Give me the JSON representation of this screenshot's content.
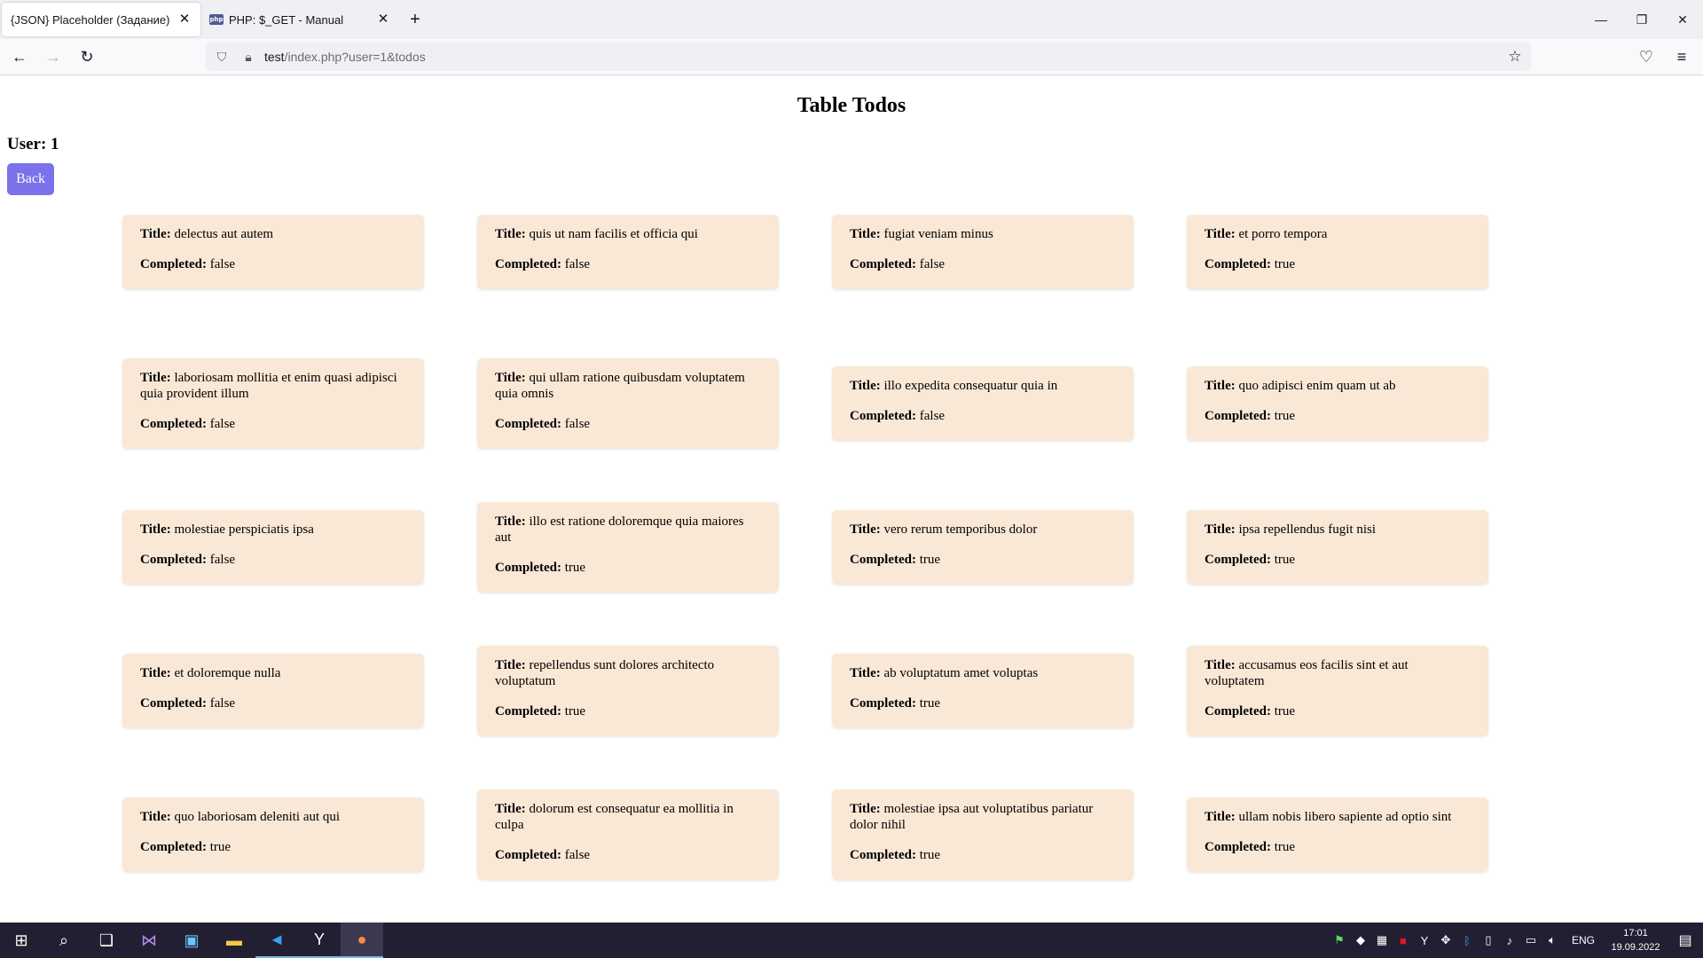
{
  "browser": {
    "tabs": [
      {
        "label": "{JSON} Placeholder (Задание)",
        "active": true
      },
      {
        "label": "PHP: $_GET - Manual",
        "active": false,
        "favicon": "php"
      }
    ],
    "url": {
      "host": "test",
      "path": "/index.php?user=1&todos"
    }
  },
  "page": {
    "title": "Table Todos",
    "user_label": "User: 1",
    "back_label": "Back",
    "title_key": "Title:",
    "completed_key": "Completed:",
    "todos": [
      {
        "title": "delectus aut autem",
        "completed": "false"
      },
      {
        "title": "quis ut nam facilis et officia qui",
        "completed": "false"
      },
      {
        "title": "fugiat veniam minus",
        "completed": "false"
      },
      {
        "title": "et porro tempora",
        "completed": "true"
      },
      {
        "title": "laboriosam mollitia et enim quasi adipisci quia provident illum",
        "completed": "false"
      },
      {
        "title": "qui ullam ratione quibusdam voluptatem quia omnis",
        "completed": "false"
      },
      {
        "title": "illo expedita consequatur quia in",
        "completed": "false"
      },
      {
        "title": "quo adipisci enim quam ut ab",
        "completed": "true"
      },
      {
        "title": "molestiae perspiciatis ipsa",
        "completed": "false"
      },
      {
        "title": "illo est ratione doloremque quia maiores aut",
        "completed": "true"
      },
      {
        "title": "vero rerum temporibus dolor",
        "completed": "true"
      },
      {
        "title": "ipsa repellendus fugit nisi",
        "completed": "true"
      },
      {
        "title": "et doloremque nulla",
        "completed": "false"
      },
      {
        "title": "repellendus sunt dolores architecto voluptatum",
        "completed": "true"
      },
      {
        "title": "ab voluptatum amet voluptas",
        "completed": "true"
      },
      {
        "title": "accusamus eos facilis sint et aut voluptatem",
        "completed": "true"
      },
      {
        "title": "quo laboriosam deleniti aut qui",
        "completed": "true"
      },
      {
        "title": "dolorum est consequatur ea mollitia in culpa",
        "completed": "false"
      },
      {
        "title": "molestiae ipsa aut voluptatibus pariatur dolor nihil",
        "completed": "true"
      },
      {
        "title": "ullam nobis libero sapiente ad optio sint",
        "completed": "true"
      }
    ]
  },
  "taskbar": {
    "language": "ENG",
    "time": "17:01",
    "date": "19.09.2022"
  },
  "colors": {
    "card_bg": "#f9e8d6",
    "back_button": "#7b71ea",
    "taskbar": "#231f33"
  }
}
